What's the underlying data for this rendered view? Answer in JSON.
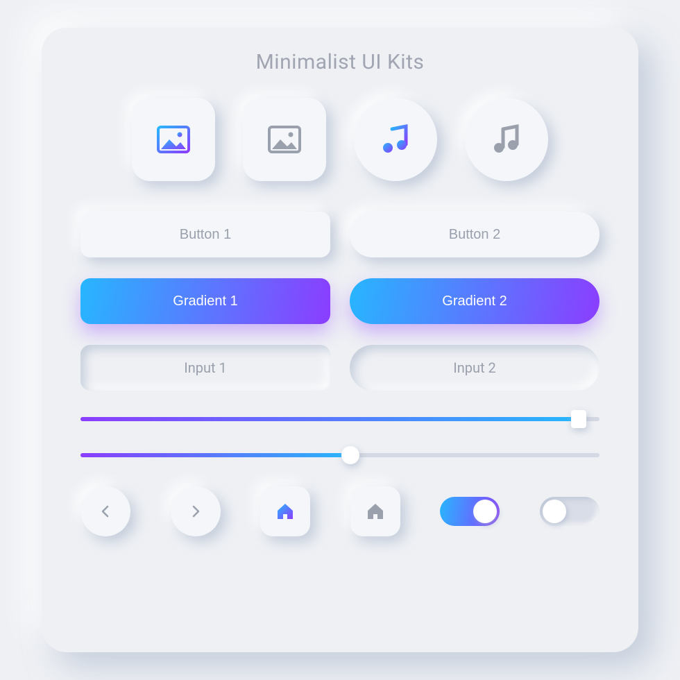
{
  "title": "Minimalist UI Kits",
  "colors": {
    "gradient_start": "#27b6ff",
    "gradient_end": "#8b3dff",
    "muted": "#9aa0ac"
  },
  "icon_tiles": [
    {
      "icon": "image-icon",
      "shape": "square",
      "style": "gradient"
    },
    {
      "icon": "image-icon",
      "shape": "square",
      "style": "muted"
    },
    {
      "icon": "music-icon",
      "shape": "round",
      "style": "gradient"
    },
    {
      "icon": "music-icon",
      "shape": "round",
      "style": "muted"
    }
  ],
  "buttons_plain": {
    "left": "Button 1",
    "right": "Button 2"
  },
  "buttons_gradient": {
    "left": "Gradient 1",
    "right": "Gradient 2"
  },
  "inputs": {
    "left": "Input 1",
    "right": "Input 2"
  },
  "sliders": [
    {
      "value_pct": 96,
      "handle": "square"
    },
    {
      "value_pct": 52,
      "handle": "round"
    }
  ],
  "nav": {
    "prev_icon": "chevron-left-icon",
    "next_icon": "chevron-right-icon",
    "home_active_icon": "home-icon",
    "home_inactive_icon": "home-icon"
  },
  "toggles": [
    {
      "state": "on"
    },
    {
      "state": "off"
    }
  ]
}
